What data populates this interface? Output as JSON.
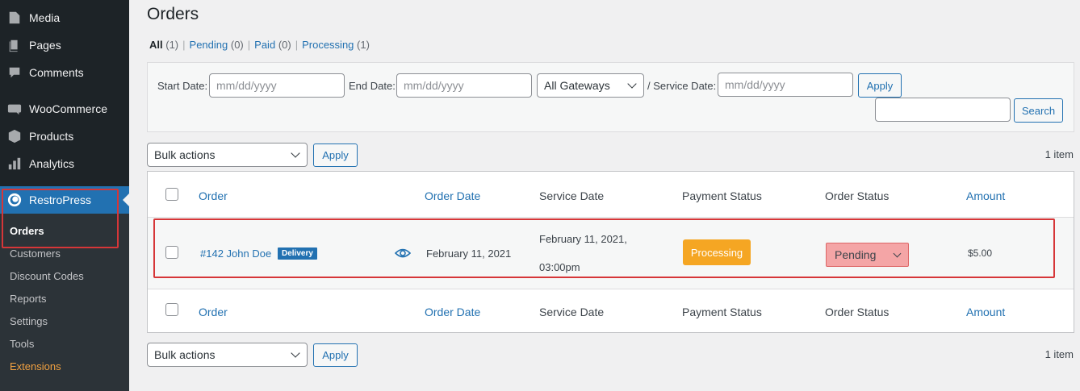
{
  "sidebar": {
    "items": [
      {
        "label": "Media",
        "icon": "media-icon"
      },
      {
        "label": "Pages",
        "icon": "pages-icon"
      },
      {
        "label": "Comments",
        "icon": "comments-icon"
      },
      {
        "label": "WooCommerce",
        "icon": "woocommerce-icon"
      },
      {
        "label": "Products",
        "icon": "products-icon"
      },
      {
        "label": "Analytics",
        "icon": "analytics-icon"
      },
      {
        "label": "RestroPress",
        "icon": "restropress-icon"
      }
    ],
    "submenu": [
      "Orders",
      "Customers",
      "Discount Codes",
      "Reports",
      "Settings",
      "Tools",
      "Extensions"
    ]
  },
  "page": {
    "title": "Orders",
    "filters": [
      {
        "label": "All",
        "count": "(1)"
      },
      {
        "label": "Pending",
        "count": "(0)"
      },
      {
        "label": "Paid",
        "count": "(0)"
      },
      {
        "label": "Processing",
        "count": "(1)"
      }
    ],
    "separator": "|"
  },
  "filter_panel": {
    "start_label": "Start Date:",
    "start_placeholder": "mm/dd/yyyy",
    "end_label": "End Date:",
    "end_placeholder": "mm/dd/yyyy",
    "gateway_value": "All Gateways",
    "service_label": "/ Service Date:",
    "service_placeholder": "mm/dd/yyyy",
    "apply_label": "Apply",
    "search_label": "Search"
  },
  "bulk": {
    "value": "Bulk actions",
    "apply_label": "Apply",
    "item_count": "1 item"
  },
  "table": {
    "columns": [
      "Order",
      "Order Date",
      "Service Date",
      "Payment Status",
      "Order Status",
      "Amount"
    ],
    "rows": [
      {
        "order": "#142 John Doe",
        "order_type": "Delivery",
        "order_date": "February 11, 2021",
        "service_date_line1": "February 11, 2021,",
        "service_date_line2": "03:00pm",
        "payment_status": "Processing",
        "order_status": "Pending",
        "amount": "$5.00"
      }
    ]
  },
  "colors": {
    "accent": "#2271b1",
    "sidebar_bg": "#1d2327",
    "processing_badge": "#f5a623",
    "pending_status": "#f4a5a6",
    "highlight_box": "#d63638"
  }
}
